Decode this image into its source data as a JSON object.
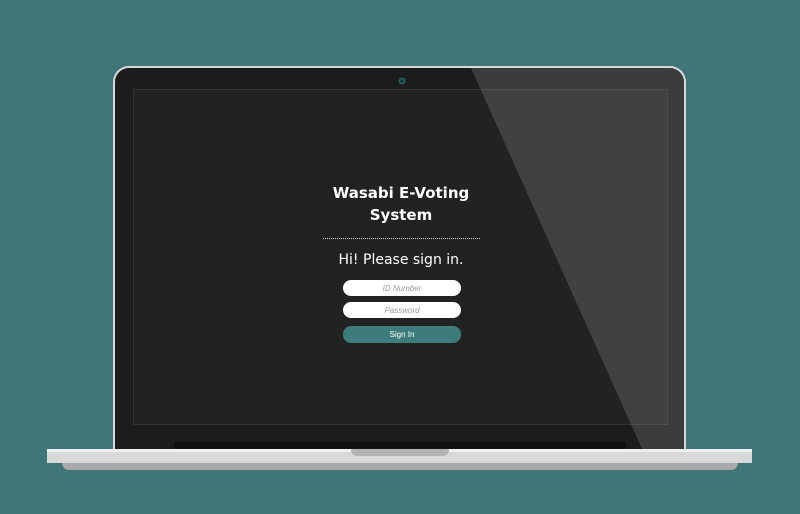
{
  "login": {
    "title_line1": "Wasabi E-Voting",
    "title_line2": "System",
    "greeting": "Hi! Please sign in.",
    "id_placeholder": "ID Number",
    "password_placeholder": "Password",
    "signin_label": "Sign In"
  },
  "colors": {
    "background": "#3f7778",
    "screen": "#222222",
    "button": "#3e7b7b"
  },
  "icons": {
    "camera": "webcam-dot"
  }
}
